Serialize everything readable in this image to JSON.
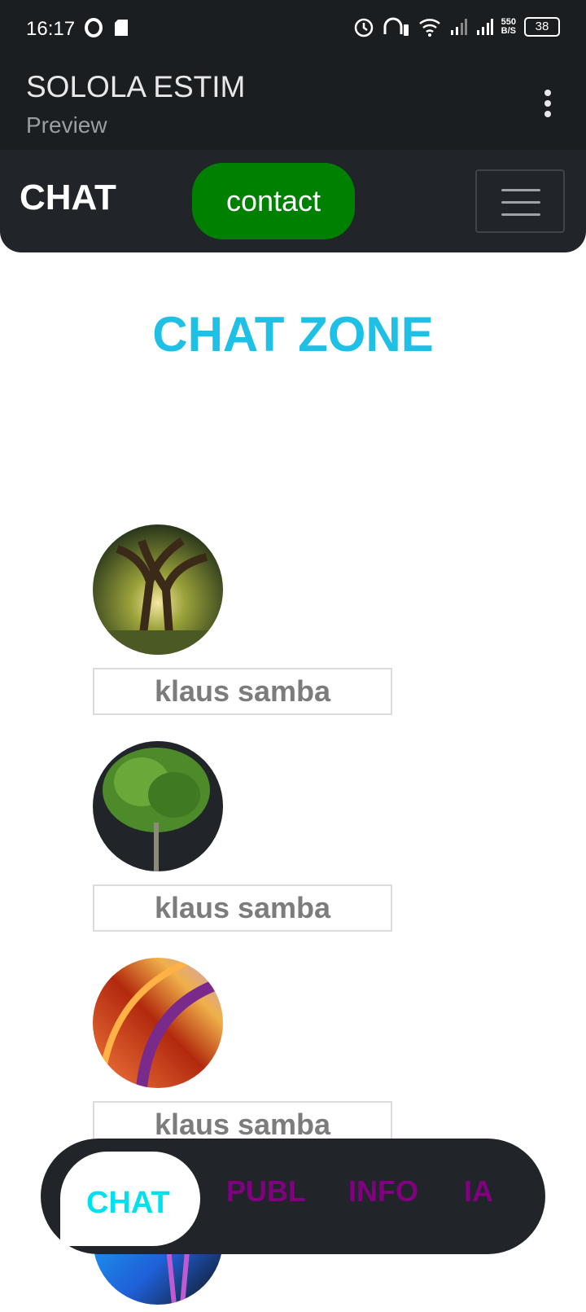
{
  "status_bar": {
    "time": "16:17",
    "net_speed_value": "550",
    "net_speed_unit": "B/S",
    "battery": "38"
  },
  "app_bar": {
    "title": "SOLOLA ESTIM",
    "subtitle": "Preview"
  },
  "navbar": {
    "brand": "CHAT",
    "contact_button": "contact"
  },
  "main": {
    "title": "CHAT ZONE"
  },
  "contacts": [
    {
      "name": "klaus samba",
      "avatar": "forest-trees-image"
    },
    {
      "name": "klaus samba",
      "avatar": "green-tree-image"
    },
    {
      "name": "klaus samba",
      "avatar": "abstract-orange-purple-image"
    },
    {
      "name": "",
      "avatar": "abstract-blue-image"
    }
  ],
  "bottom_nav": {
    "tabs": [
      {
        "label": "CHAT",
        "active": true
      },
      {
        "label": "PUBL",
        "active": false
      },
      {
        "label": "INFO",
        "active": false
      },
      {
        "label": "IA",
        "active": false
      }
    ]
  },
  "colors": {
    "accent_cyan": "#1ec0e6",
    "contact_green": "#008000",
    "tab_purple": "#800080",
    "dark": "#212529"
  }
}
